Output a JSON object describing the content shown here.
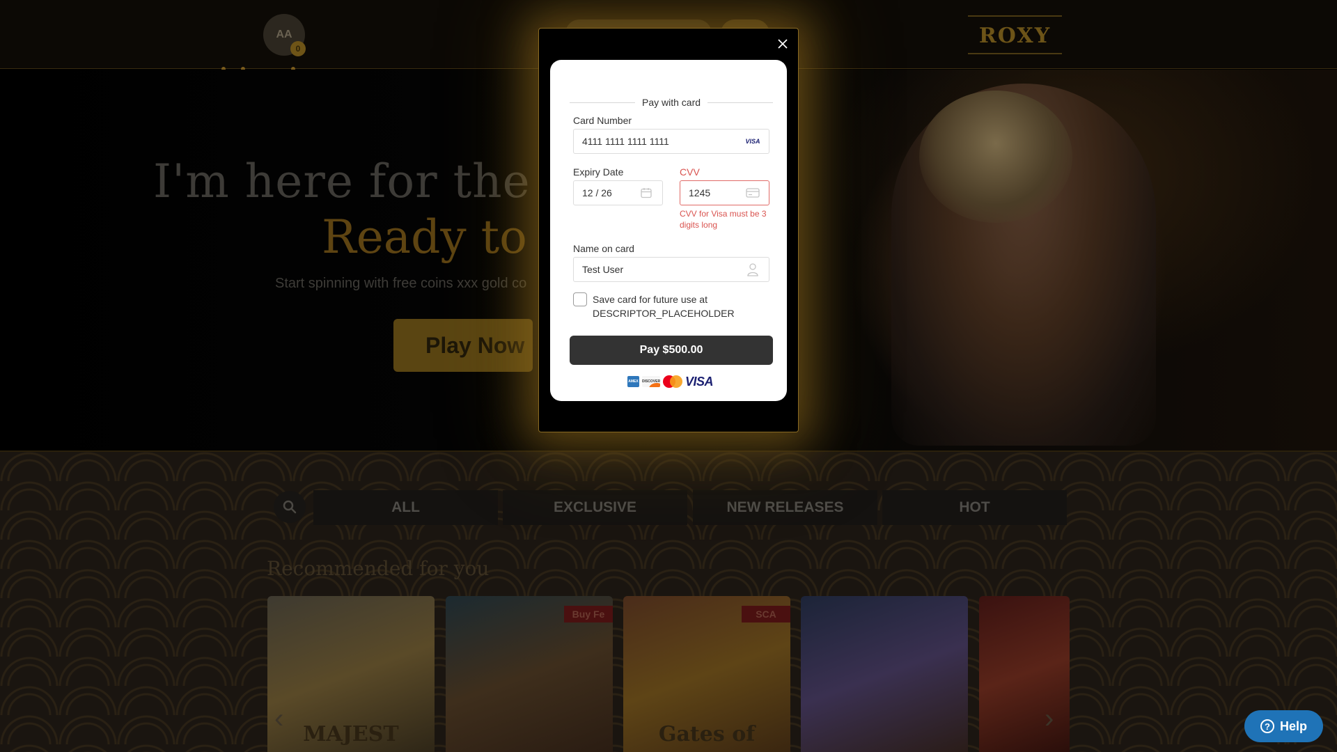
{
  "header": {
    "avatar_initials": "AA",
    "avatar_badge": "0",
    "logo_text": "ROXY"
  },
  "hero": {
    "title_line1": "I'm here for the ga",
    "title_line2": "Ready to p",
    "subtitle": "Start spinning with free coins xxx gold co",
    "play_label": "Play Now"
  },
  "categories": [
    "ALL",
    "EXCLUSIVE",
    "NEW RELEASES",
    "HOT"
  ],
  "section_title": "Recommended for you",
  "games": {
    "tile1_mark": "MAJEST",
    "tile2_tag": "Buy Fe",
    "tile3_tag": "SCA",
    "tile3_mark": "Gates of"
  },
  "modal": {
    "pay_with_card": "Pay with card",
    "card_number_label": "Card Number",
    "card_number_value": "4111 1111 1111 1111",
    "card_brand_mini": "VISA",
    "expiry_label": "Expiry Date",
    "expiry_value": "12 / 26",
    "cvv_label": "CVV",
    "cvv_value": "1245",
    "cvv_error": "CVV for Visa must be 3 digits long",
    "name_label": "Name on card",
    "name_value": "Test User",
    "save_card_label": "Save card for future use at DESCRIPTOR_PLACEHOLDER",
    "save_card_checked": false,
    "pay_button": "Pay $500.00",
    "brands": {
      "amex": "AMEX",
      "discover": "DISCOVER",
      "visa": "VISA"
    }
  },
  "help": {
    "label": "Help"
  },
  "colors": {
    "accent_gold": "#8a6a22",
    "error": "#d9534f",
    "pay_button_bg": "#333333",
    "help_blue": "#1f73b7"
  }
}
